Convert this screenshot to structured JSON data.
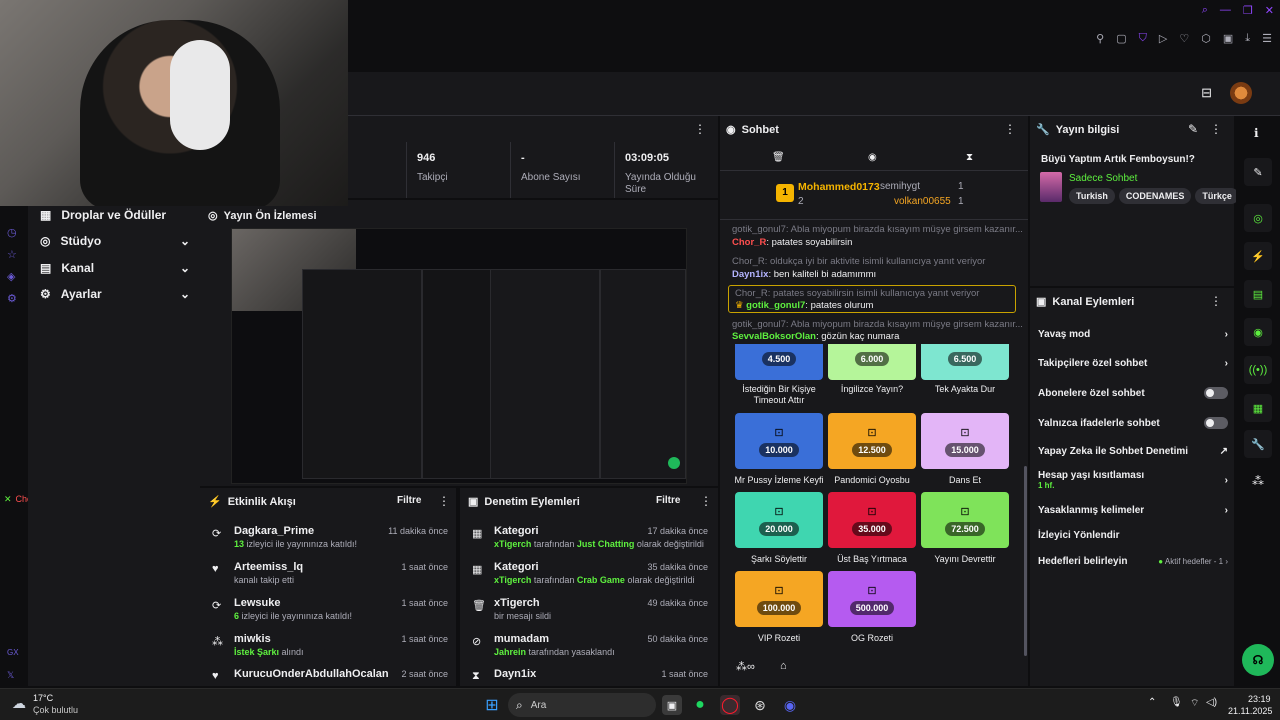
{
  "left_rail": {
    "username": "Chor_R",
    "footer": "GX"
  },
  "nav": {
    "items": [
      {
        "label": "Droplar ve Ödüller"
      },
      {
        "label": "Stüdyo"
      },
      {
        "label": "Kanal"
      },
      {
        "label": "Ayarlar"
      }
    ]
  },
  "stats": [
    {
      "value": "946",
      "label": "Takipçi"
    },
    {
      "value": "-",
      "label": "Abone Sayısı"
    },
    {
      "value": "03:09:05",
      "label": "Yayında Olduğu Süre"
    }
  ],
  "preview": {
    "title": "Yayın Ön İzlemesi"
  },
  "activity": {
    "title": "Etkinlik Akışı",
    "filter": "Filtre",
    "items": [
      {
        "name": "Dagkara_Prime",
        "count": "13",
        "desc": " izleyici ile yayınınıza katıldı!",
        "time": "11 dakika önce"
      },
      {
        "name": "Arteemiss_lq",
        "desc": "kanalı takip etti",
        "time": "1 saat önce"
      },
      {
        "name": "Lewsuke",
        "count": "6",
        "desc": " izleyici ile yayınınıza katıldı!",
        "time": "1 saat önce"
      },
      {
        "name": "miwkis",
        "highlight": "İstek Şarkı",
        "desc": " alındı",
        "time": "1 saat önce"
      },
      {
        "name": "KurucuOnderAbdullahOcalan",
        "time": "2 saat önce"
      }
    ]
  },
  "moderation": {
    "title": "Denetim Eylemleri",
    "filter": "Filtre",
    "items": [
      {
        "name": "Kategori",
        "user": "xTigerch",
        "mid": " tarafından ",
        "value": "Just Chatting",
        "end": " olarak değiştirildi",
        "time": "17 dakika önce"
      },
      {
        "name": "Kategori",
        "user": "xTigerch",
        "mid": " tarafından ",
        "value": "Crab Game",
        "end": " olarak değiştirildi",
        "time": "35 dakika önce"
      },
      {
        "name": "xTigerch",
        "end": "bir mesajı sildi",
        "time": "49 dakika önce"
      },
      {
        "name": "mumadam",
        "user": "Jahrein",
        "end": " tarafından yasaklandı",
        "time": "50 dakika önce"
      },
      {
        "name": "Dayn1ix",
        "time": "1 saat önce"
      }
    ]
  },
  "chat": {
    "title": "Sohbet",
    "leaderboard": {
      "first": "Mohammed0173",
      "first_count": "2",
      "second": "semihygt",
      "second_count": "1",
      "third": "volkan00655",
      "third_count": "1",
      "rank": "1"
    },
    "messages": [
      {
        "reply": "gotik_gonul7: Abla miyopum birazda kısayım müşye girsem kazanır..."
      },
      {
        "user": "Chor_R",
        "text": "patates soyabilirsin",
        "color": "#ff4f4f"
      },
      {
        "reply": "Chor_R: oldukça iyi bir aktivite isimli kullanıcıya yanıt veriyor"
      },
      {
        "user": "Dayn1ix",
        "text": "ben kaliteli bi adamımmı",
        "color": "#b4b4ff"
      },
      {
        "reply": "Chor_R: patates soyabilirsin isimli kullanıcıya yanıt veriyor"
      },
      {
        "user": "gotik_gonul7",
        "text": "patates olurum",
        "color": "#5ef03f"
      },
      {
        "reply": "gotik_gonul7: Abla miyopum birazda kısayım müşye girsem kazanır..."
      },
      {
        "user": "SevvalBoksorOlan",
        "text": "gözün kaç numara",
        "color": "#5ef03f"
      }
    ],
    "rewards": [
      {
        "cost": "4.500",
        "label": "İstediğin Bir Kişiye Timeout Attır",
        "color": "#3a6fd8"
      },
      {
        "cost": "6.000",
        "label": "İngilizce Yayın?",
        "color": "#b5f59a"
      },
      {
        "cost": "6.500",
        "label": "Tek Ayakta Dur",
        "color": "#7ee6d0"
      },
      {
        "cost": "10.000",
        "label": "Mr Pussy İzleme Keyfi",
        "color": "#3a6fd8"
      },
      {
        "cost": "12.500",
        "label": "Pandomici Oyosbu",
        "color": "#f5a623"
      },
      {
        "cost": "15.000",
        "label": "Dans Et",
        "color": "#e3b5f7"
      },
      {
        "cost": "20.000",
        "label": "Şarkı Söylettir",
        "color": "#3fd6b0"
      },
      {
        "cost": "35.000",
        "label": "Üst Baş Yırtmaca",
        "color": "#e0183c"
      },
      {
        "cost": "72.500",
        "label": "Yayını Devrettir",
        "color": "#7fe35a"
      },
      {
        "cost": "100.000",
        "label": "VIP Rozeti",
        "color": "#f5a623"
      },
      {
        "cost": "500.000",
        "label": "OG Rozeti",
        "color": "#b55bf0"
      }
    ]
  },
  "stream_info": {
    "title": "Yayın bilgisi",
    "stream_title": "Büyü Yaptım Artık Femboysun!?",
    "chat_mode": "Sadece Sohbet",
    "tags": [
      "Turkish",
      "CODENAMES",
      "Türkçe"
    ]
  },
  "channel_actions": {
    "title": "Kanal Eylemleri",
    "items": [
      {
        "label": "Yavaş mod",
        "type": "chevron"
      },
      {
        "label": "Takipçilere özel sohbet",
        "type": "chevron"
      },
      {
        "label": "Abonelere özel sohbet",
        "type": "toggle"
      },
      {
        "label": "Yalnızca ifadelerle sohbet",
        "type": "toggle"
      },
      {
        "label": "Yapay Zeka ile Sohbet Denetimi",
        "type": "external"
      },
      {
        "label": "Hesap yaşı kısıtlaması",
        "sub": "1 hf.",
        "type": "chevron"
      },
      {
        "label": "Yasaklanmış kelimeler",
        "type": "chevron"
      },
      {
        "label": "İzleyici Yönlendir",
        "type": "none"
      },
      {
        "label": "Hedefleri belirleyin",
        "sub_right": "Aktif hedefler - 1",
        "type": "chevron"
      }
    ]
  },
  "taskbar": {
    "temp": "17°C",
    "weather": "Çok bulutlu",
    "search": "Ara",
    "time": "23:19",
    "date": "21.11.2025"
  }
}
